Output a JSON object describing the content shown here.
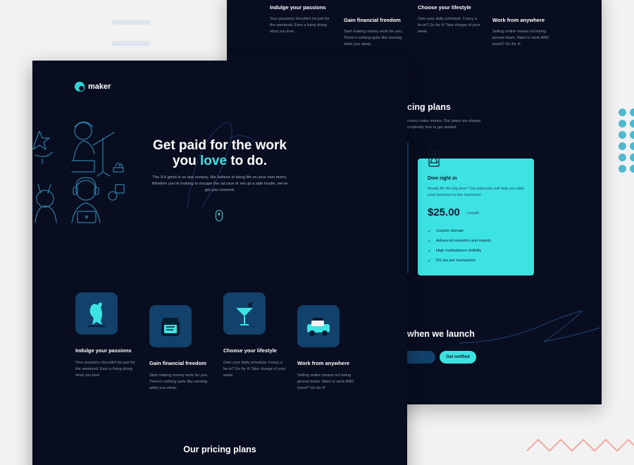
{
  "colors": {
    "background": "#080d20",
    "accent": "#3de3e3",
    "tile": "#12416b",
    "muted": "#8f98ad"
  },
  "back_page": {
    "features": [
      {
        "title": "Indulge your passions",
        "text": "Your passions shouldn't be just for the weekend. Earn a living doing what you love."
      },
      {
        "title": "Gain financial freedom",
        "text": "Start making money work for you. There's nothing quite like earning while you sleep."
      },
      {
        "title": "Choose your lifestyle",
        "text": "Own your daily schedule. Fancy a lie-in? Go for it! Take charge of your week."
      },
      {
        "title": "Work from anywhere",
        "text": "Selling online means not being pinned down. Want to work AND travel? Go for it!"
      }
    ],
    "pricing": {
      "title_partial": "cing plans",
      "text_line1": "eators make money. Our plans are always",
      "text_line2": "ompletely free to get started."
    },
    "plan_card": {
      "icon": "flask-icon",
      "title": "Dive right in",
      "text": "Ready for the big time? Our paid plan will help you take your business to the next level.",
      "price": "$25.00",
      "period": "/ month",
      "features": [
        "Custom domain",
        "Advanced analytics and reports",
        "High marketplace visibility",
        "5% fee per transaction"
      ]
    },
    "notify": {
      "title_partial": "when we launch",
      "button": "Get notified"
    }
  },
  "front_page": {
    "logo": {
      "text": "maker",
      "icon": "maker-logo-icon"
    },
    "hero": {
      "title_line1": "Get paid for the work",
      "title_you": "you",
      "title_love": "love",
      "title_end": "to do.",
      "text": "The 9-5 grind is so last century. We believe in living life on your own terms. Whether you're looking to escape the rat race or set up a side hustle, we've got you covered."
    },
    "features": [
      {
        "icon": "passions-icon",
        "title": "Indulge your passions",
        "text": "Your passions shouldn't be just for the weekend. Earn a living doing what you love."
      },
      {
        "icon": "financial-icon",
        "title": "Gain financial freedom",
        "text": "Start making money work for you. There's nothing quite like earning while you sleep."
      },
      {
        "icon": "lifestyle-icon",
        "title": "Choose your lifestyle",
        "text": "Own your daily schedule. Fancy a lie-in? Go for it! Take charge of your week."
      },
      {
        "icon": "work-anywhere-icon",
        "title": "Work from anywhere",
        "text": "Selling online means not being pinned down. Want to work AND travel? Go for it!"
      }
    ],
    "pricing_title": "Our pricing plans"
  }
}
